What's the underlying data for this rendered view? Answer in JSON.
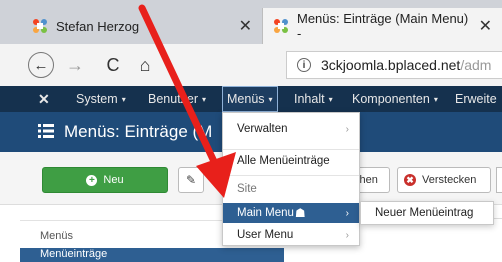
{
  "browser": {
    "tabs": [
      {
        "title": "Stefan Herzog",
        "close": "✕",
        "active": false
      },
      {
        "title": "Menüs: Einträge (Main Menu) -",
        "close": "✕",
        "active": true
      }
    ],
    "nav": {
      "back": "←",
      "forward": "→",
      "reload": "C",
      "home": "⌂"
    },
    "url": {
      "host": "3ckjoomla.bplaced.net",
      "path": "/adm",
      "info": "i"
    }
  },
  "adminbar": {
    "logo": "✕",
    "items": [
      "System",
      "Benutzer",
      "Menüs",
      "Inhalt",
      "Komponenten",
      "Erweite"
    ],
    "caret": "▾"
  },
  "page": {
    "title": "Menüs: Einträge (M"
  },
  "toolbar": {
    "new_label": "Neu",
    "edit_icon": "✎",
    "cut_label": "chen",
    "hide_label": "Verstecken",
    "hide_icon": "✖"
  },
  "sidebar": {
    "label": "Menüs",
    "items": [
      "Menüeinträge"
    ]
  },
  "dropdown": {
    "items": [
      {
        "label": "Verwalten",
        "arrow": "›"
      },
      {
        "label": "Alle Menüeinträge"
      },
      {
        "label": "Site"
      },
      {
        "label": "Main Menu",
        "arrow": "›",
        "active": true
      },
      {
        "label": "User Menu",
        "arrow": "›"
      }
    ],
    "submenu": {
      "label": "Neuer Menüeintrag"
    }
  },
  "colors": {
    "adminbar": "#15314e",
    "titleband": "#1f4b79",
    "new_button": "#3f9e44",
    "active": "#2e5f92",
    "annotation": "#e8201b"
  }
}
